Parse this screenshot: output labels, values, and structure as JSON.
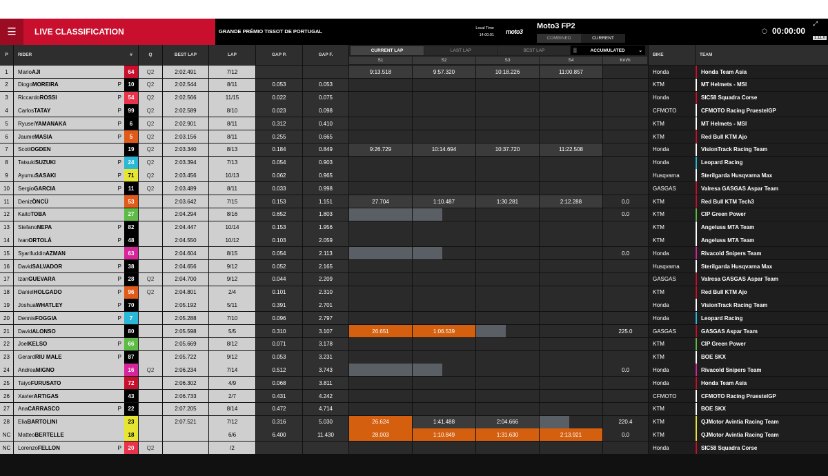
{
  "header": {
    "title": "LIVE CLASSIFICATION",
    "race": "GRANDE PRÉMIO TISSOT DE PORTUGAL",
    "local_time_label": "Local Time",
    "local_time": "14:00:01",
    "logo": "moto3",
    "session": "Moto3 FP2",
    "tabs": [
      "COMBINED",
      "CURRENT"
    ],
    "active_tab": 1,
    "timer": "00:00:00",
    "version": "1.11.0"
  },
  "columns": {
    "pos": "P",
    "rider": "RIDER",
    "num": "#",
    "q": "Q",
    "best": "BEST LAP",
    "lap": "LAP",
    "gapp": "GAP P.",
    "gapf": "GAP F.",
    "bike": "BIKE",
    "team": "TEAM",
    "view_tabs": [
      "CURRENT LAP",
      "LAST LAP",
      "BEST LAP"
    ],
    "accumulated": "ACCUMULATED",
    "sectors": [
      "S1",
      "S2",
      "S3",
      "S4"
    ],
    "speed": "Km/h"
  },
  "colors": {
    "accent": "#c8102e",
    "sector_orange": "#d4600f",
    "sector_grey": "#5a5f66"
  },
  "rows": [
    {
      "p": "1",
      "first": "Mario",
      "last": "AJI",
      "pit": "",
      "num": "64",
      "nc": "#c8102e",
      "ntc": "#fff",
      "q": "Q2",
      "best": "2:02.491",
      "lap": "7/12",
      "gp": "",
      "gf": "",
      "s": [
        "9:13.518",
        "9:57.320",
        "10:18.226",
        "11:00.857"
      ],
      "st": [
        "t",
        "t",
        "t",
        "t"
      ],
      "spd": "",
      "bike": "Honda",
      "team": "Honda Team Asia",
      "tc": "#c8102e"
    },
    {
      "p": "2",
      "first": "Diogo",
      "last": "MOREIRA",
      "pit": "P",
      "num": "10",
      "nc": "#000",
      "ntc": "#fff",
      "q": "Q2",
      "best": "2:02.544",
      "lap": "8/11",
      "gp": "0.053",
      "gf": "0.053",
      "s": [
        "",
        "",
        "",
        ""
      ],
      "st": [
        "",
        "",
        "",
        ""
      ],
      "spd": "",
      "bike": "KTM",
      "team": "MT Helmets - MSI",
      "tc": "#ffffff"
    },
    {
      "p": "3",
      "first": "Riccardo",
      "last": "ROSSI",
      "pit": "P",
      "num": "54",
      "nc": "#e8334a",
      "ntc": "#fff",
      "q": "Q2",
      "best": "2:02.566",
      "lap": "11/15",
      "gp": "0.022",
      "gf": "0.075",
      "s": [
        "",
        "",
        "",
        ""
      ],
      "st": [
        "",
        "",
        "",
        ""
      ],
      "spd": "",
      "bike": "Honda",
      "team": "SIC58 Squadra Corse",
      "tc": "#c8102e"
    },
    {
      "p": "4",
      "first": "Carlos",
      "last": "TATAY",
      "pit": "P",
      "num": "99",
      "nc": "#000",
      "ntc": "#fff",
      "q": "Q2",
      "best": "2:02.589",
      "lap": "8/10",
      "gp": "0.023",
      "gf": "0.098",
      "s": [
        "",
        "",
        "",
        ""
      ],
      "st": [
        "",
        "",
        "",
        ""
      ],
      "spd": "",
      "bike": "CFMOTO",
      "team": "CFMOTO Racing PruestelGP",
      "tc": "#ffffff"
    },
    {
      "p": "5",
      "first": "Ryusei",
      "last": "YAMANAKA",
      "pit": "P",
      "num": "6",
      "nc": "#000",
      "ntc": "#fff",
      "q": "Q2",
      "best": "2:02.901",
      "lap": "8/11",
      "gp": "0.312",
      "gf": "0.410",
      "s": [
        "",
        "",
        "",
        ""
      ],
      "st": [
        "",
        "",
        "",
        ""
      ],
      "spd": "",
      "bike": "KTM",
      "team": "MT Helmets - MSI",
      "tc": "#ffffff"
    },
    {
      "p": "6",
      "first": "Jaume",
      "last": "MASIA",
      "pit": "P",
      "num": "5",
      "nc": "#e05a1a",
      "ntc": "#fff",
      "q": "Q2",
      "best": "2:03.156",
      "lap": "8/11",
      "gp": "0.255",
      "gf": "0.665",
      "s": [
        "",
        "",
        "",
        ""
      ],
      "st": [
        "",
        "",
        "",
        ""
      ],
      "spd": "",
      "bike": "KTM",
      "team": "Red Bull KTM Ajo",
      "tc": "#c8102e"
    },
    {
      "p": "7",
      "first": "Scott",
      "last": "OGDEN",
      "pit": "",
      "num": "19",
      "nc": "#000",
      "ntc": "#fff",
      "q": "Q2",
      "best": "2:03.340",
      "lap": "8/13",
      "gp": "0.184",
      "gf": "0.849",
      "s": [
        "9:26.729",
        "10:14.694",
        "10:37.720",
        "11:22.508"
      ],
      "st": [
        "t",
        "t",
        "t",
        "t"
      ],
      "spd": "",
      "bike": "Honda",
      "team": "VisionTrack Racing Team",
      "tc": "#ffffff"
    },
    {
      "p": "8",
      "first": "Tatsuki",
      "last": "SUZUKI",
      "pit": "P",
      "num": "24",
      "nc": "#2bb8d6",
      "ntc": "#fff",
      "q": "Q2",
      "best": "2:03.394",
      "lap": "7/13",
      "gp": "0.054",
      "gf": "0.903",
      "s": [
        "",
        "",
        "",
        ""
      ],
      "st": [
        "",
        "",
        "",
        ""
      ],
      "spd": "",
      "bike": "Honda",
      "team": "Leopard Racing",
      "tc": "#2bb8d6"
    },
    {
      "p": "9",
      "first": "Ayumu",
      "last": "SASAKI",
      "pit": "P",
      "num": "71",
      "nc": "#e6e632",
      "ntc": "#000",
      "q": "Q2",
      "best": "2:03.456",
      "lap": "10/13",
      "gp": "0.062",
      "gf": "0.965",
      "s": [
        "",
        "",
        "",
        ""
      ],
      "st": [
        "",
        "",
        "",
        ""
      ],
      "spd": "",
      "bike": "Husqvarna",
      "team": "Sterilgarda Husqvarna Max",
      "tc": "#ffffff"
    },
    {
      "p": "10",
      "first": "Sergio",
      "last": "GARCIA",
      "pit": "P",
      "num": "11",
      "nc": "#000",
      "ntc": "#fff",
      "q": "Q2",
      "best": "2:03.489",
      "lap": "8/11",
      "gp": "0.033",
      "gf": "0.998",
      "s": [
        "",
        "",
        "",
        ""
      ],
      "st": [
        "",
        "",
        "",
        ""
      ],
      "spd": "",
      "bike": "GASGAS",
      "team": "Valresa GASGAS Aspar Team",
      "tc": "#c8102e"
    },
    {
      "p": "11",
      "first": "Deniz",
      "last": "ÖNCÜ",
      "pit": "",
      "num": "53",
      "nc": "#e05a1a",
      "ntc": "#fff",
      "q": "",
      "best": "2:03.642",
      "lap": "7/15",
      "gp": "0.153",
      "gf": "1.151",
      "s": [
        "27.704",
        "1:10.487",
        "1:30.281",
        "2:12.288"
      ],
      "st": [
        "t",
        "t",
        "t",
        "t"
      ],
      "spd": "0.0",
      "bike": "KTM",
      "team": "Red Bull KTM Tech3",
      "tc": "#c8102e"
    },
    {
      "p": "12",
      "first": "Kaito",
      "last": "TOBA",
      "pit": "",
      "num": "27",
      "nc": "#5dbb46",
      "ntc": "#fff",
      "q": "",
      "best": "2:04.294",
      "lap": "8/16",
      "gp": "0.652",
      "gf": "1.803",
      "s": [
        "",
        "",
        "",
        ""
      ],
      "st": [
        "g",
        "g",
        "",
        ""
      ],
      "spd": "0.0",
      "bike": "KTM",
      "team": "CIP Green Power",
      "tc": "#5dbb46"
    },
    {
      "p": "13",
      "first": "Stefano",
      "last": "NEPA",
      "pit": "P",
      "num": "82",
      "nc": "#000",
      "ntc": "#fff",
      "q": "",
      "best": "2:04.447",
      "lap": "10/14",
      "gp": "0.153",
      "gf": "1.956",
      "s": [
        "",
        "",
        "",
        ""
      ],
      "st": [
        "",
        "",
        "",
        ""
      ],
      "spd": "",
      "bike": "KTM",
      "team": "Angeluss MTA Team",
      "tc": "#ffffff"
    },
    {
      "p": "14",
      "first": "Ivan",
      "last": "ORTOLÁ",
      "pit": "P",
      "num": "48",
      "nc": "#000",
      "ntc": "#fff",
      "q": "",
      "best": "2:04.550",
      "lap": "10/12",
      "gp": "0.103",
      "gf": "2.059",
      "s": [
        "",
        "",
        "",
        ""
      ],
      "st": [
        "",
        "",
        "",
        ""
      ],
      "spd": "",
      "bike": "KTM",
      "team": "Angeluss MTA Team",
      "tc": "#ffffff"
    },
    {
      "p": "15",
      "first": "Syarifuddin",
      "last": "AZMAN",
      "pit": "",
      "num": "63",
      "nc": "#d6249a",
      "ntc": "#fff",
      "q": "",
      "best": "2:04.604",
      "lap": "8/15",
      "gp": "0.054",
      "gf": "2.113",
      "s": [
        "",
        "",
        "",
        ""
      ],
      "st": [
        "g",
        "g",
        "",
        ""
      ],
      "spd": "0.0",
      "bike": "Honda",
      "team": "Rivacold Snipers Team",
      "tc": "#d6249a"
    },
    {
      "p": "16",
      "first": "David",
      "last": "SALVADOR",
      "pit": "P",
      "num": "38",
      "nc": "#000",
      "ntc": "#fff",
      "q": "",
      "best": "2:04.656",
      "lap": "9/12",
      "gp": "0.052",
      "gf": "2.165",
      "s": [
        "",
        "",
        "",
        ""
      ],
      "st": [
        "",
        "",
        "",
        ""
      ],
      "spd": "",
      "bike": "Husqvarna",
      "team": "Sterilgarda Husqvarna Max",
      "tc": "#ffffff"
    },
    {
      "p": "17",
      "first": "Izan",
      "last": "GUEVARA",
      "pit": "P",
      "num": "28",
      "nc": "#000",
      "ntc": "#fff",
      "q": "Q2",
      "best": "2:04.700",
      "lap": "9/12",
      "gp": "0.044",
      "gf": "2.209",
      "s": [
        "",
        "",
        "",
        ""
      ],
      "st": [
        "",
        "",
        "",
        ""
      ],
      "spd": "",
      "bike": "GASGAS",
      "team": "Valresa GASGAS Aspar Team",
      "tc": "#c8102e"
    },
    {
      "p": "18",
      "first": "Daniel",
      "last": "HOLGADO",
      "pit": "P",
      "num": "96",
      "nc": "#e05a1a",
      "ntc": "#fff",
      "q": "Q2",
      "best": "2:04.801",
      "lap": "2/4",
      "gp": "0.101",
      "gf": "2.310",
      "s": [
        "",
        "",
        "",
        ""
      ],
      "st": [
        "",
        "",
        "",
        ""
      ],
      "spd": "",
      "bike": "KTM",
      "team": "Red Bull KTM Ajo",
      "tc": "#c8102e"
    },
    {
      "p": "19",
      "first": "Joshua",
      "last": "WHATLEY",
      "pit": "P",
      "num": "70",
      "nc": "#000",
      "ntc": "#fff",
      "q": "",
      "best": "2:05.192",
      "lap": "5/11",
      "gp": "0.391",
      "gf": "2.701",
      "s": [
        "",
        "",
        "",
        ""
      ],
      "st": [
        "",
        "",
        "",
        ""
      ],
      "spd": "",
      "bike": "Honda",
      "team": "VisionTrack Racing Team",
      "tc": "#ffffff"
    },
    {
      "p": "20",
      "first": "Dennis",
      "last": "FOGGIA",
      "pit": "P",
      "num": "7",
      "nc": "#2bb8d6",
      "ntc": "#fff",
      "q": "",
      "best": "2:05.288",
      "lap": "7/10",
      "gp": "0.096",
      "gf": "2.797",
      "s": [
        "",
        "",
        "",
        ""
      ],
      "st": [
        "",
        "",
        "",
        ""
      ],
      "spd": "",
      "bike": "Honda",
      "team": "Leopard Racing",
      "tc": "#2bb8d6"
    },
    {
      "p": "21",
      "first": "David",
      "last": "ALONSO",
      "pit": "",
      "num": "80",
      "nc": "#000",
      "ntc": "#fff",
      "q": "",
      "best": "2:05.598",
      "lap": "5/5",
      "gp": "0.310",
      "gf": "3.107",
      "s": [
        "26.651",
        "1:06.539",
        "",
        ""
      ],
      "st": [
        "o",
        "o",
        "g",
        ""
      ],
      "spd": "225.0",
      "bike": "GASGAS",
      "team": "GASGAS Aspar Team",
      "tc": "#c8102e"
    },
    {
      "p": "22",
      "first": "Joel",
      "last": "KELSO",
      "pit": "P",
      "num": "66",
      "nc": "#5dbb46",
      "ntc": "#fff",
      "q": "",
      "best": "2:05.669",
      "lap": "8/12",
      "gp": "0.071",
      "gf": "3.178",
      "s": [
        "",
        "",
        "",
        ""
      ],
      "st": [
        "",
        "",
        "",
        ""
      ],
      "spd": "",
      "bike": "KTM",
      "team": "CIP Green Power",
      "tc": "#5dbb46"
    },
    {
      "p": "23",
      "first": "Gerard",
      "last": "RIU MALE",
      "pit": "P",
      "num": "87",
      "nc": "#000",
      "ntc": "#fff",
      "q": "",
      "best": "2:05.722",
      "lap": "9/12",
      "gp": "0.053",
      "gf": "3.231",
      "s": [
        "",
        "",
        "",
        ""
      ],
      "st": [
        "",
        "",
        "",
        ""
      ],
      "spd": "",
      "bike": "KTM",
      "team": "BOE SKX",
      "tc": "#ffffff"
    },
    {
      "p": "24",
      "first": "Andrea",
      "last": "MIGNO",
      "pit": "",
      "num": "16",
      "nc": "#d6249a",
      "ntc": "#fff",
      "q": "Q2",
      "best": "2:06.234",
      "lap": "7/14",
      "gp": "0.512",
      "gf": "3.743",
      "s": [
        "",
        "",
        "",
        ""
      ],
      "st": [
        "g",
        "g",
        "",
        ""
      ],
      "spd": "0.0",
      "bike": "Honda",
      "team": "Rivacold Snipers Team",
      "tc": "#d6249a"
    },
    {
      "p": "25",
      "first": "Taiyo",
      "last": "FURUSATO",
      "pit": "",
      "num": "72",
      "nc": "#c8102e",
      "ntc": "#fff",
      "q": "",
      "best": "2:06.302",
      "lap": "4/9",
      "gp": "0.068",
      "gf": "3.811",
      "s": [
        "",
        "",
        "",
        ""
      ],
      "st": [
        "",
        "",
        "",
        ""
      ],
      "spd": "",
      "bike": "Honda",
      "team": "Honda Team Asia",
      "tc": "#c8102e"
    },
    {
      "p": "26",
      "first": "Xavier",
      "last": "ARTIGAS",
      "pit": "",
      "num": "43",
      "nc": "#000",
      "ntc": "#fff",
      "q": "",
      "best": "2:06.733",
      "lap": "2/7",
      "gp": "0.431",
      "gf": "4.242",
      "s": [
        "",
        "",
        "",
        ""
      ],
      "st": [
        "",
        "",
        "",
        ""
      ],
      "spd": "",
      "bike": "CFMOTO",
      "team": "CFMOTO Racing PruestelGP",
      "tc": "#ffffff"
    },
    {
      "p": "27",
      "first": "Ana",
      "last": "CARRASCO",
      "pit": "P",
      "num": "22",
      "nc": "#000",
      "ntc": "#fff",
      "q": "",
      "best": "2:07.205",
      "lap": "8/14",
      "gp": "0.472",
      "gf": "4.714",
      "s": [
        "",
        "",
        "",
        ""
      ],
      "st": [
        "",
        "",
        "",
        ""
      ],
      "spd": "",
      "bike": "KTM",
      "team": "BOE SKX",
      "tc": "#ffffff"
    },
    {
      "p": "28",
      "first": "Elia",
      "last": "BARTOLINI",
      "pit": "",
      "num": "23",
      "nc": "#e6e632",
      "ntc": "#000",
      "q": "",
      "best": "2:07.521",
      "lap": "7/12",
      "gp": "0.316",
      "gf": "5.030",
      "s": [
        "26.624",
        "1:41.488",
        "2:04.666",
        ""
      ],
      "st": [
        "o",
        "t",
        "t",
        "g"
      ],
      "spd": "220.4",
      "bike": "KTM",
      "team": "QJMotor Avintia Racing Team",
      "tc": "#e6e632"
    },
    {
      "p": "NC",
      "first": "Matteo",
      "last": "BERTELLE",
      "pit": "",
      "num": "18",
      "nc": "#e6e632",
      "ntc": "#000",
      "q": "",
      "best": "",
      "lap": "6/6",
      "gp": "6.400",
      "gf": "11.430",
      "s": [
        "28.003",
        "1:10.849",
        "1:31.630",
        "2:13.921"
      ],
      "st": [
        "o",
        "o",
        "o",
        "o"
      ],
      "spd": "0.0",
      "bike": "KTM",
      "team": "QJMotor Avintia Racing Team",
      "tc": "#e6e632"
    },
    {
      "p": "NC",
      "first": "Lorenzo",
      "last": "FELLON",
      "pit": "P",
      "num": "20",
      "nc": "#e8334a",
      "ntc": "#fff",
      "q": "Q2",
      "best": "",
      "lap": "/2",
      "gp": "",
      "gf": "",
      "s": [
        "",
        "",
        "",
        ""
      ],
      "st": [
        "",
        "",
        "",
        ""
      ],
      "spd": "",
      "bike": "Honda",
      "team": "SIC58 Squadra Corse",
      "tc": "#c8102e"
    }
  ]
}
